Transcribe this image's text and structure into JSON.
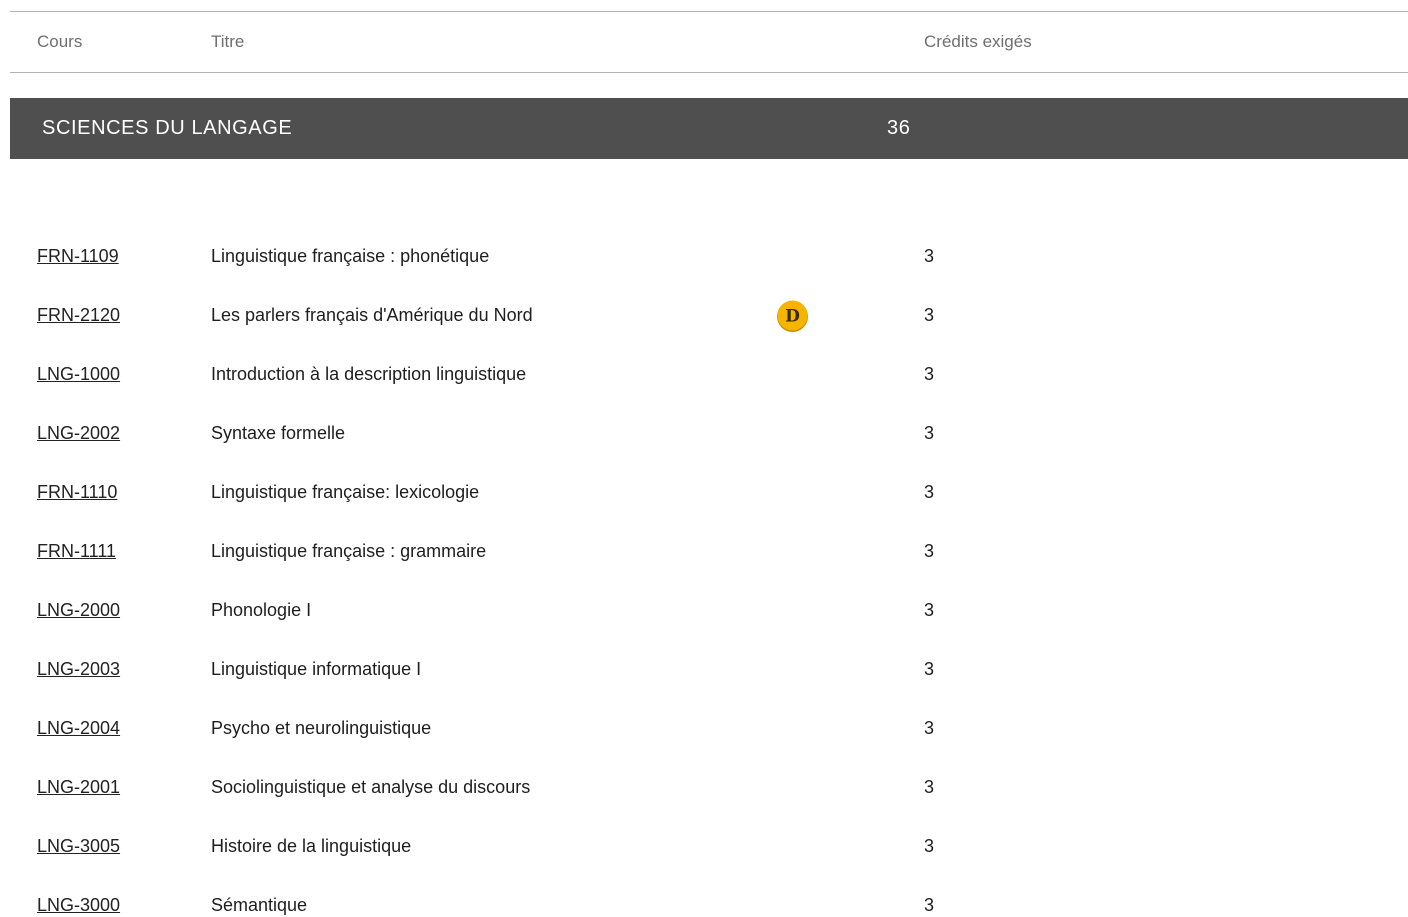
{
  "header": {
    "col_course": "Cours",
    "col_title": "Titre",
    "col_credits": "Crédits exigés"
  },
  "section": {
    "title": "SCIENCES DU LANGAGE",
    "credits": "36"
  },
  "colors": {
    "section_bar": "#4f4f4f",
    "badge_fill": "#f4b400",
    "badge_letter": "#3a2a00"
  },
  "badge": {
    "letter": "D",
    "icon": "distance-course-badge-icon"
  },
  "courses": [
    {
      "code": "FRN-1109",
      "title": "Linguistique française : phonétique",
      "credits": "3",
      "badge": false
    },
    {
      "code": "FRN-2120",
      "title": "Les parlers français d'Amérique du Nord",
      "credits": "3",
      "badge": true
    },
    {
      "code": "LNG-1000",
      "title": "Introduction à la description linguistique",
      "credits": "3",
      "badge": false
    },
    {
      "code": "LNG-2002",
      "title": "Syntaxe formelle",
      "credits": "3",
      "badge": false
    },
    {
      "code": "FRN-1110",
      "title": "Linguistique française: lexicologie",
      "credits": "3",
      "badge": false
    },
    {
      "code": "FRN-1111",
      "title": "Linguistique française : grammaire",
      "credits": "3",
      "badge": false
    },
    {
      "code": "LNG-2000",
      "title": "Phonologie I",
      "credits": "3",
      "badge": false
    },
    {
      "code": "LNG-2003",
      "title": "Linguistique informatique I",
      "credits": "3",
      "badge": false
    },
    {
      "code": "LNG-2004",
      "title": "Psycho et neurolinguistique",
      "credits": "3",
      "badge": false
    },
    {
      "code": "LNG-2001",
      "title": "Sociolinguistique et analyse du discours",
      "credits": "3",
      "badge": false
    },
    {
      "code": "LNG-3005",
      "title": "Histoire de la linguistique",
      "credits": "3",
      "badge": false
    },
    {
      "code": "LNG-3000",
      "title": "Sémantique",
      "credits": "3",
      "badge": false
    }
  ]
}
